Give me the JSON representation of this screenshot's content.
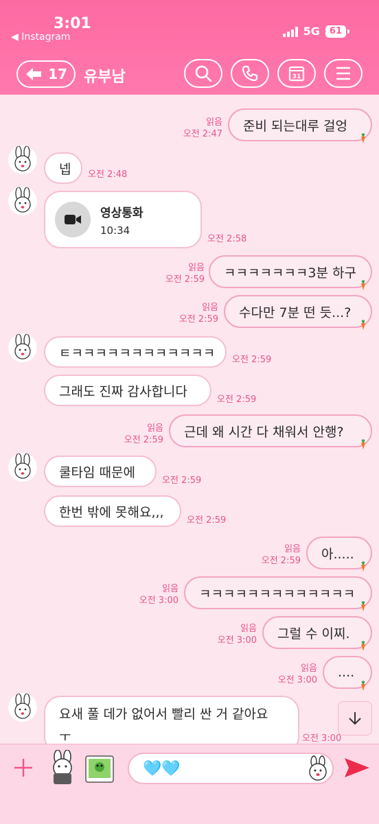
{
  "status": {
    "time": "3:01",
    "back_app": "◀ Instagram",
    "network": "5G",
    "battery": "61"
  },
  "header": {
    "unread": "17",
    "title": "유부남"
  },
  "messages": [
    {
      "side": "out",
      "text": "준비 되는대루 걸엉",
      "read": "읽음",
      "time": "오전 2:47"
    },
    {
      "side": "in",
      "text": "넵",
      "time": "오전 2:48"
    },
    {
      "side": "in",
      "type": "video_call",
      "title": "영상통화",
      "duration": "10:34",
      "time": "오전 2:58"
    },
    {
      "side": "out",
      "text": "ㅋㅋㅋㅋㅋㅋㅋ3분 하구",
      "read": "읽음",
      "time": "오전 2:59"
    },
    {
      "side": "out",
      "text": "수다만 7분 떤 듯...?",
      "read": "읽음",
      "time": "오전 2:59"
    },
    {
      "side": "in",
      "text": "ㅌㅋㅋㅋㅋㅋㅋㅋㅋㅋㅋㅋㅋ",
      "time": "오전 2:59"
    },
    {
      "side": "in",
      "text": "그래도 진짜 감사합니다",
      "time": "오전 2:59"
    },
    {
      "side": "out",
      "text": "근데 왜 시간 다 채워서 안행?",
      "read": "읽음",
      "time": "오전 2:59"
    },
    {
      "side": "in",
      "text": "쿨타임 때문에",
      "time": "오전 2:59"
    },
    {
      "side": "in",
      "text": "한번 밖에 못해요,,,",
      "time": "오전 2:59"
    },
    {
      "side": "out",
      "text": "아.....",
      "read": "읽음",
      "time": "오전 2:59"
    },
    {
      "side": "out",
      "text": "ㅋㅋㅋㅋㅋㅋㅋㅋㅋㅋㅋㅋㅋ",
      "read": "읽음",
      "time": "오전 3:00"
    },
    {
      "side": "out",
      "text": "그럴 수 이찌.",
      "read": "읽음",
      "time": "오전 3:00"
    },
    {
      "side": "out",
      "text": "....",
      "read": "읽음",
      "time": "오전 3:00"
    },
    {
      "side": "in",
      "text": "요새 풀 데가 없어서 빨리 싼 거 같아요",
      "text2": "ㅜ",
      "time": "오전 3:00"
    }
  ],
  "input": {
    "value": "🩵🩵"
  },
  "icons": [
    "back-arrow-icon",
    "search-icon",
    "phone-icon",
    "calendar-icon",
    "menu-icon",
    "video-camera-icon",
    "carrot-icon",
    "plus-icon",
    "sticker-icon",
    "photo-icon",
    "emoji-icon",
    "send-icon",
    "chevron-down-icon"
  ],
  "colors": {
    "accent": "#ff6fa6",
    "bubble_border": "#f3a5c2",
    "meta": "#e8558c",
    "background": "#fde6ee"
  }
}
